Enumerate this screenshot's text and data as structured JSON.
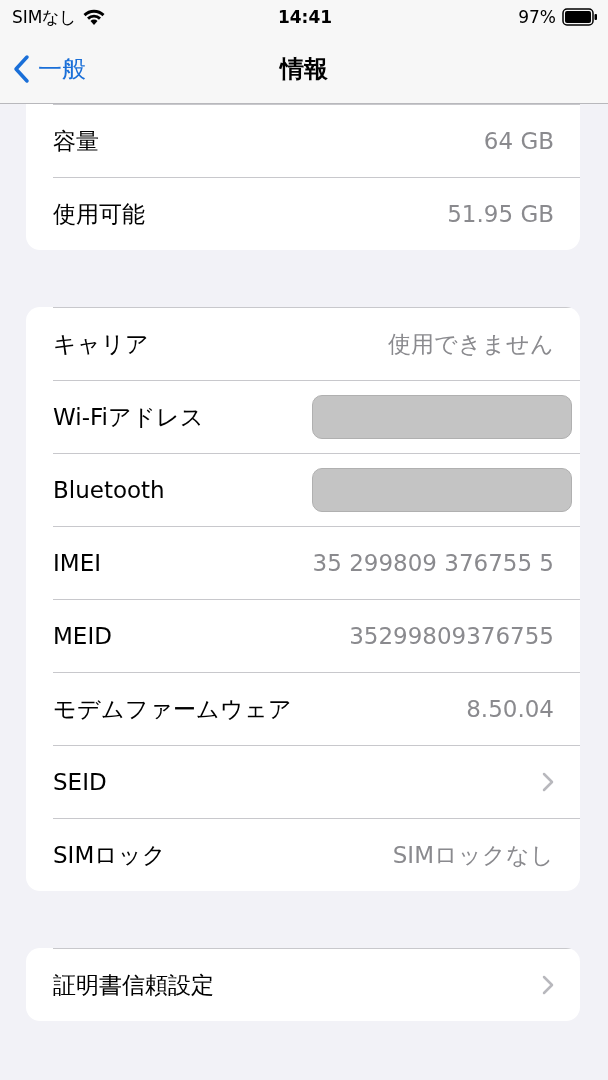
{
  "status_bar": {
    "carrier": "SIMなし",
    "time": "14:41",
    "battery": "97%"
  },
  "nav": {
    "back": "一般",
    "title": "情報"
  },
  "groups": [
    {
      "rows": [
        {
          "kind": "value",
          "label": "容量",
          "value": "64 GB"
        },
        {
          "kind": "value",
          "label": "使用可能",
          "value": "51.95 GB"
        }
      ]
    },
    {
      "rows": [
        {
          "kind": "value",
          "label": "キャリア",
          "value": "使用できません"
        },
        {
          "kind": "redacted",
          "label": "Wi-Fiアドレス"
        },
        {
          "kind": "redacted",
          "label": "Bluetooth"
        },
        {
          "kind": "value",
          "label": "IMEI",
          "value": "35 299809 376755 5"
        },
        {
          "kind": "value",
          "label": "MEID",
          "value": "35299809376755"
        },
        {
          "kind": "value",
          "label": "モデムファームウェア",
          "value": "8.50.04"
        },
        {
          "kind": "chevron",
          "label": "SEID"
        },
        {
          "kind": "value",
          "label": "SIMロック",
          "value": "SIMロックなし"
        }
      ]
    },
    {
      "rows": [
        {
          "kind": "chevron",
          "label": "証明書信頼設定"
        }
      ]
    }
  ]
}
